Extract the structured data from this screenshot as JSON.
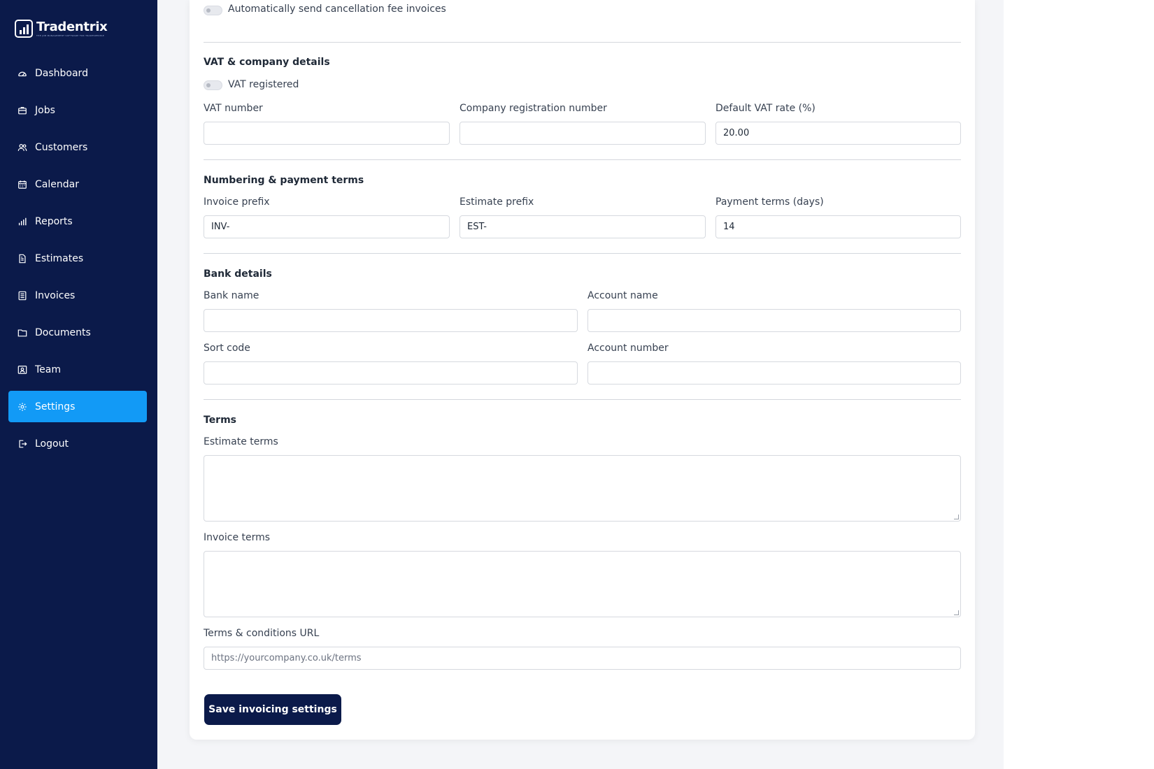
{
  "brand": {
    "name": "Tradentrix",
    "tagline": "THE JOB MANAGEMENT SOFTWARE FOR TRADESPEOPLE"
  },
  "nav": [
    {
      "label": "Dashboard",
      "icon": "dashboard-icon"
    },
    {
      "label": "Jobs",
      "icon": "briefcase-icon"
    },
    {
      "label": "Customers",
      "icon": "users-icon"
    },
    {
      "label": "Calendar",
      "icon": "calendar-icon"
    },
    {
      "label": "Reports",
      "icon": "bar-chart-icon"
    },
    {
      "label": "Estimates",
      "icon": "file-text-icon"
    },
    {
      "label": "Invoices",
      "icon": "list-icon"
    },
    {
      "label": "Documents",
      "icon": "folder-icon"
    },
    {
      "label": "Team",
      "icon": "id-card-icon"
    },
    {
      "label": "Settings",
      "icon": "gear-icon",
      "active": true
    },
    {
      "label": "Logout",
      "icon": "logout-icon"
    }
  ],
  "colors": {
    "sidebar": "#0b1a4a",
    "accent": "#129af6",
    "button": "#0b1a4a"
  },
  "cancellation": {
    "toggle_label": "Automatically send cancellation fee invoices",
    "enabled": false
  },
  "vat": {
    "title": "VAT & company details",
    "registered_label": "VAT registered",
    "registered": false,
    "vat_number_label": "VAT number",
    "vat_number_value": "",
    "company_reg_label": "Company registration number",
    "company_reg_value": "",
    "default_rate_label": "Default VAT rate (%)",
    "default_rate_value": "20.00"
  },
  "numbering": {
    "title": "Numbering & payment terms",
    "invoice_prefix_label": "Invoice prefix",
    "invoice_prefix_value": "INV-",
    "estimate_prefix_label": "Estimate prefix",
    "estimate_prefix_value": "EST-",
    "payment_terms_label": "Payment terms (days)",
    "payment_terms_value": "14"
  },
  "bank": {
    "title": "Bank details",
    "bank_name_label": "Bank name",
    "bank_name_value": "",
    "account_name_label": "Account name",
    "account_name_value": "",
    "sort_code_label": "Sort code",
    "sort_code_value": "",
    "account_number_label": "Account number",
    "account_number_value": ""
  },
  "terms": {
    "title": "Terms",
    "estimate_terms_label": "Estimate terms",
    "estimate_terms_value": "",
    "invoice_terms_label": "Invoice terms",
    "invoice_terms_value": "",
    "url_label": "Terms & conditions URL",
    "url_placeholder": "https://yourcompany.co.uk/terms"
  },
  "save_button": "Save invoicing settings"
}
